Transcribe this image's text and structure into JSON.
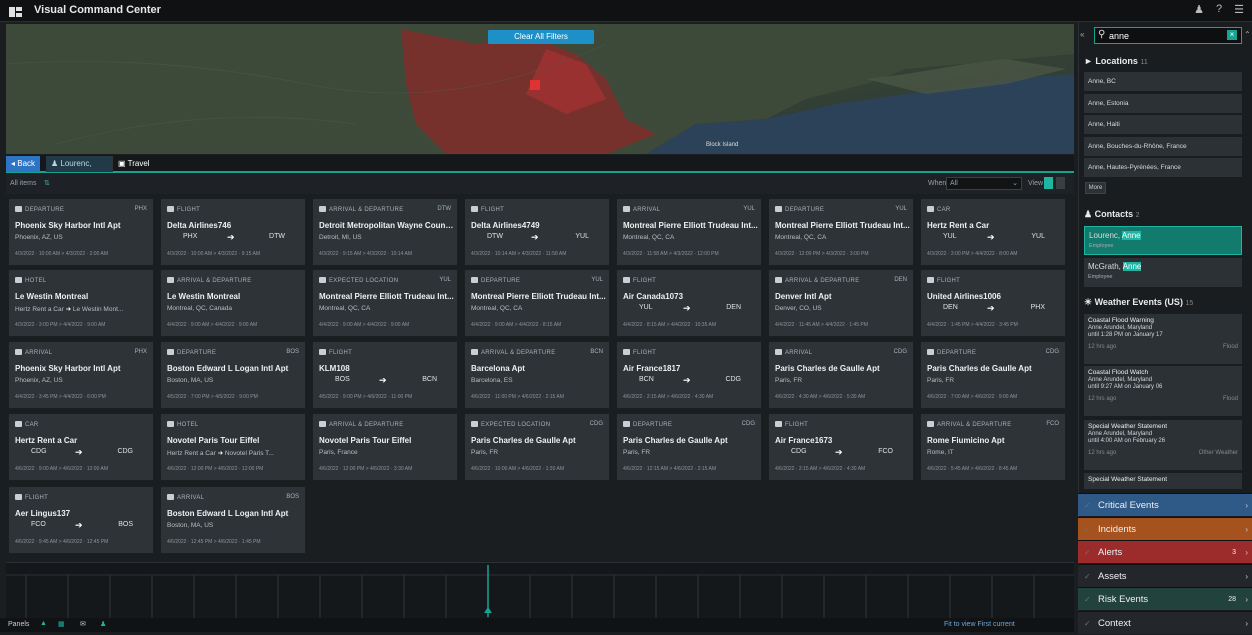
{
  "app": {
    "title": "Visual Command Center"
  },
  "map": {
    "clear_filters": "Clear All Filters",
    "labels": [
      "Block Island"
    ]
  },
  "tabs": {
    "back": "◂ Back",
    "person": "Lourenc, Anne",
    "travel": "Travel"
  },
  "filters": {
    "all_items": "All items",
    "when_label": "When",
    "when_value": "All",
    "view_label": "View"
  },
  "cards": [
    {
      "type": "DEPARTURE",
      "code": "PHX",
      "title": "Phoenix Sky Harbor Intl Apt",
      "sub": "Phoenix, AZ, US",
      "foot": "4/3/2022 · 10:00 AM   >   4/3/2022 · 2:00 AM"
    },
    {
      "type": "FLIGHT",
      "code": "",
      "title": "Delta Airlines746",
      "from": "PHX",
      "to": "DTW",
      "foot": "4/3/2022 · 10:00 AM   >   4/3/2022 · 9:15 AM"
    },
    {
      "type": "ARRIVAL & DEPARTURE",
      "code": "DTW",
      "title": "Detroit Metropolitan Wayne County...",
      "sub": "Detroit, MI, US",
      "foot": "4/3/2022 · 9:15 AM   >   4/3/2022 · 10:14 AM"
    },
    {
      "type": "FLIGHT",
      "code": "",
      "title": "Delta Airlines4749",
      "from": "DTW",
      "to": "YUL",
      "foot": "4/3/2022 · 10:14 AM   >   4/3/2022 · 11:58 AM"
    },
    {
      "type": "ARRIVAL",
      "code": "YUL",
      "title": "Montreal Pierre Elliott Trudeau Int...",
      "sub": "Montreal, QC, CA",
      "foot": "4/3/2022 · 11:58 AM   >   4/3/2022 · 12:00 PM"
    },
    {
      "type": "DEPARTURE",
      "code": "YUL",
      "title": "Montreal Pierre Elliott Trudeau Int...",
      "sub": "Montreal, QC, CA",
      "foot": "4/3/2022 · 12:00 PM   >   4/3/2022 · 3:00 PM"
    },
    {
      "type": "CAR",
      "code": "",
      "title": "Hertz Rent a Car",
      "from": "YUL",
      "to": "YUL",
      "foot": "4/3/2022 · 3:00 PM   >   4/4/2022 · 8:00 AM"
    },
    {
      "type": "HOTEL",
      "code": "",
      "title": "Le Westin Montreal",
      "hotel": "Hertz Rent a Car",
      "hotel_to": "Le Westin Mont...",
      "foot": "4/3/2022 · 3:00 PM   >   4/4/2022 · 9:00 AM"
    },
    {
      "type": "ARRIVAL & DEPARTURE",
      "code": "",
      "title": "Le Westin Montreal",
      "sub": "Montreal, QC, Canada",
      "foot": "4/4/2022 · 9:00 AM   >   4/4/2022 · 9:00 AM"
    },
    {
      "type": "EXPECTED LOCATION",
      "code": "YUL",
      "title": "Montreal Pierre Elliott Trudeau Int...",
      "sub": "Montreal, QC, CA",
      "foot": "4/4/2022 · 9:00 AM   >   4/4/2022 · 9:00 AM"
    },
    {
      "type": "DEPARTURE",
      "code": "YUL",
      "title": "Montreal Pierre Elliott Trudeau Int...",
      "sub": "Montreal, QC, CA",
      "foot": "4/4/2022 · 9:00 AM   >   4/4/2022 · 8:15 AM"
    },
    {
      "type": "FLIGHT",
      "code": "",
      "title": "Air Canada1073",
      "from": "YUL",
      "to": "DEN",
      "foot": "4/4/2022 · 8:15 AM   >   4/4/2022 · 10:35 AM"
    },
    {
      "type": "ARRIVAL & DEPARTURE",
      "code": "DEN",
      "title": "Denver Intl Apt",
      "sub": "Denver, CO, US",
      "foot": "4/4/2022 · 11:45 AM   >   4/4/2022 · 1:45 PM"
    },
    {
      "type": "FLIGHT",
      "code": "",
      "title": "United Airlines1006",
      "from": "DEN",
      "to": "PHX",
      "foot": "4/4/2022 · 1:45 PM   >   4/4/2022 · 3:45 PM"
    },
    {
      "type": "ARRIVAL",
      "code": "PHX",
      "title": "Phoenix Sky Harbor Intl Apt",
      "sub": "Phoenix, AZ, US",
      "foot": "4/4/2022 · 3:45 PM   >   4/4/2022 · 6:00 PM"
    },
    {
      "type": "DEPARTURE",
      "code": "BOS",
      "title": "Boston Edward L Logan Intl Apt",
      "sub": "Boston, MA, US",
      "foot": "4/5/2022 · 7:00 PM   >   4/5/2022 · 9:00 PM"
    },
    {
      "type": "FLIGHT",
      "code": "",
      "title": "KLM108",
      "from": "BOS",
      "to": "BCN",
      "foot": "4/5/2022 · 9:00 PM   >   4/6/2022 · 11:00 PM"
    },
    {
      "type": "ARRIVAL & DEPARTURE",
      "code": "BCN",
      "title": "Barcelona Apt",
      "sub": "Barcelona, ES",
      "foot": "4/6/2022 · 11:00 PM   >   4/6/2022 · 2:15 AM"
    },
    {
      "type": "FLIGHT",
      "code": "",
      "title": "Air France1817",
      "from": "BCN",
      "to": "CDG",
      "foot": "4/6/2022 · 2:15 AM   >   4/6/2022 · 4:30 AM"
    },
    {
      "type": "ARRIVAL",
      "code": "CDG",
      "title": "Paris Charles de Gaulle Apt",
      "sub": "Paris, FR",
      "foot": "4/6/2022 · 4:30 AM   >   4/6/2022 · 5:30 AM"
    },
    {
      "type": "DEPARTURE",
      "code": "CDG",
      "title": "Paris Charles de Gaulle Apt",
      "sub": "Paris, FR",
      "foot": "4/6/2022 · 7:00 AM   >   4/6/2022 · 9:00 AM"
    },
    {
      "type": "CAR",
      "code": "",
      "title": "Hertz Rent a Car",
      "from": "CDG",
      "to": "CDG",
      "foot": "4/6/2022 · 9:00 AM   >   4/6/2022 · 12:00 AM"
    },
    {
      "type": "HOTEL",
      "code": "",
      "title": "Novotel Paris Tour Eiffel",
      "hotel": "Hertz Rent a Car",
      "hotel_to": "Novotel Paris T...",
      "foot": "4/6/2022 · 12:00 PM   >   4/6/2022 · 12:00 PM"
    },
    {
      "type": "ARRIVAL & DEPARTURE",
      "code": "",
      "title": "Novotel Paris Tour Eiffel",
      "sub": "Paris, France",
      "foot": "4/6/2022 · 12:00 PM   >   4/6/2022 · 3:30 AM"
    },
    {
      "type": "EXPECTED LOCATION",
      "code": "CDG",
      "title": "Paris Charles de Gaulle Apt",
      "sub": "Paris, FR",
      "foot": "4/6/2022 · 10:00 AM   >   4/6/2022 · 1:30 AM"
    },
    {
      "type": "DEPARTURE",
      "code": "CDG",
      "title": "Paris Charles de Gaulle Apt",
      "sub": "Paris, FR",
      "foot": "4/6/2022 · 12:15 AM   >   4/6/2022 · 2:15 AM"
    },
    {
      "type": "FLIGHT",
      "code": "",
      "title": "Air France1673",
      "from": "CDG",
      "to": "FCO",
      "foot": "4/6/2022 · 2:15 AM   >   4/6/2022 · 4:30 AM"
    },
    {
      "type": "ARRIVAL & DEPARTURE",
      "code": "FCO",
      "title": "Rome Fiumicino Apt",
      "sub": "Rome, IT",
      "foot": "4/6/2022 · 5:45 AM   >   4/6/2022 · 8:45 AM"
    },
    {
      "type": "FLIGHT",
      "code": "",
      "title": "Aer Lingus137",
      "from": "FCO",
      "to": "BOS",
      "foot": "4/6/2022 · 9:45 AM   >   4/6/2022 · 12:45 PM"
    },
    {
      "type": "ARRIVAL",
      "code": "BOS",
      "title": "Boston Edward L Logan Intl Apt",
      "sub": "Boston, MA, US",
      "foot": "4/6/2022 · 12:45 PM   >   4/6/2022 · 1:45 PM"
    }
  ],
  "timeline": {
    "label": ""
  },
  "statusbar": {
    "panels": "Panels",
    "right": "Fit to view    First current"
  },
  "search": {
    "value": "anne"
  },
  "locations": {
    "title": "Locations",
    "count": "11",
    "more": "More",
    "items": [
      "Anne, BC",
      "Anne, Estonia",
      "Anne, Haiti",
      "Anne, Bouches-du-Rhône, France",
      "Anne, Hautes-Pyrénées, France"
    ]
  },
  "contacts": {
    "title": "Contacts",
    "count": "2",
    "items": [
      {
        "name_pre": "Lourenc, ",
        "name_hl": "Anne",
        "role": "Employee"
      },
      {
        "name_pre": "McGrath, ",
        "name_hl": "Anne",
        "role": "Employee"
      }
    ]
  },
  "weather": {
    "title": "Weather Events (US)",
    "count": "15",
    "items": [
      {
        "title": "Coastal Flood Warning",
        "l1": "Anne Arundel, Maryland",
        "l2": "until 1:28 PM on January 17",
        "meta": "12 hrs ago",
        "tag": "Flood"
      },
      {
        "title": "Coastal Flood Watch",
        "l1": "Anne Arundel, Maryland",
        "l2": "until 9:27 AM on January 06",
        "meta": "12 hrs ago",
        "tag": "Flood"
      },
      {
        "title": "Special Weather Statement",
        "l1": "Anne Arundel, Maryland",
        "l2": "until 4:00 AM on February 26",
        "meta": "12 hrs ago",
        "tag": "Other Weather"
      },
      {
        "title": "Special Weather Statement",
        "l1": "",
        "l2": "",
        "meta": "",
        "tag": ""
      }
    ]
  },
  "bands": [
    {
      "label": "Critical Events",
      "color": "#2f5a87"
    },
    {
      "label": "Incidents",
      "color": "#a5521e"
    },
    {
      "label": "Alerts",
      "color": "#9c2b2b",
      "badge": "3"
    },
    {
      "label": "Assets",
      "color": "#23272b"
    },
    {
      "label": "Risk Events",
      "color": "#22433d",
      "badge": "28"
    },
    {
      "label": "Context",
      "color": "#23272b"
    }
  ]
}
